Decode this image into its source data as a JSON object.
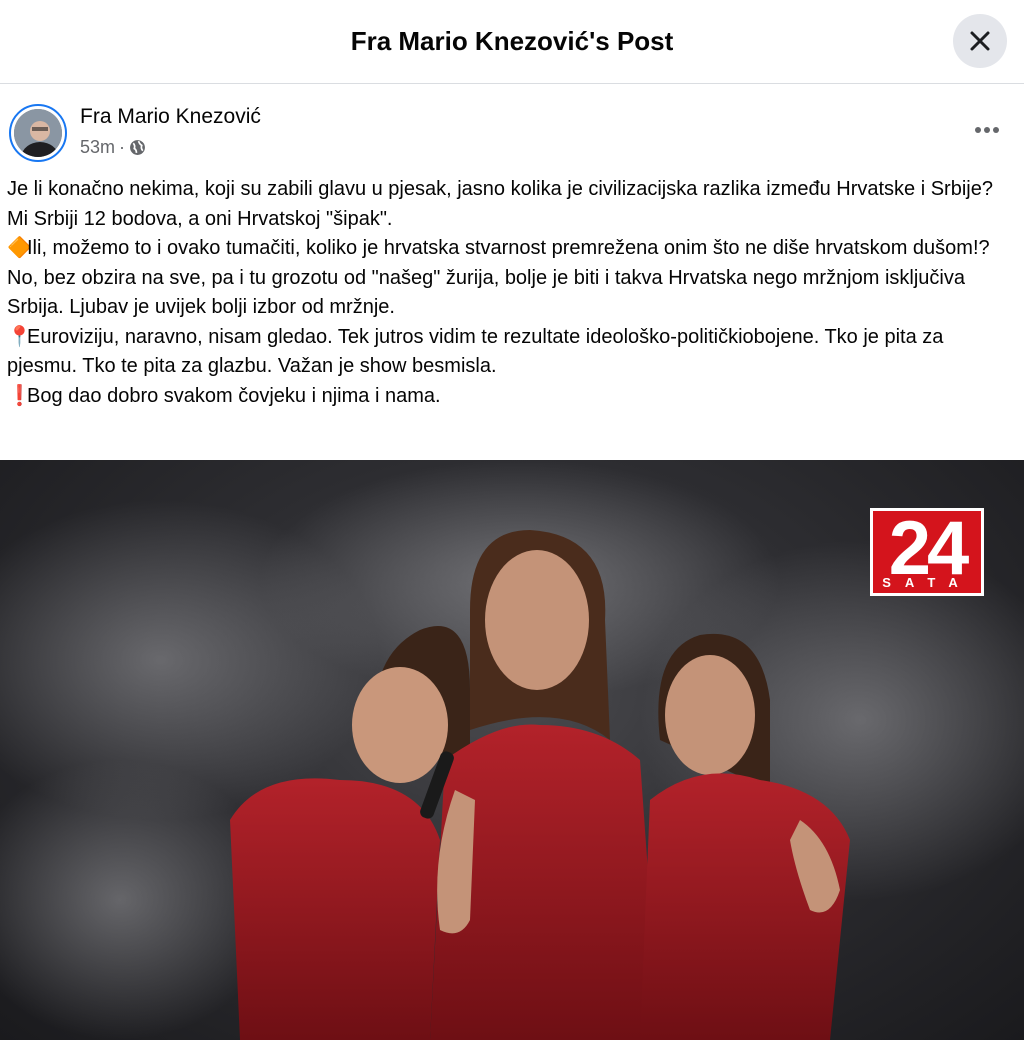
{
  "dialog": {
    "title": "Fra Mario Knezović's Post",
    "close_icon": "close-icon"
  },
  "post": {
    "author": "Fra Mario Knezović",
    "time": "53m",
    "meta_separator": "·",
    "privacy_icon": "globe-icon",
    "more_icon": "more-horizontal-icon",
    "paragraphs": [
      {
        "emoji": "",
        "text": "Je li konačno nekima, koji su zabili glavu u pjesak, jasno kolika je civilizacijska razlika između Hrvatske i Srbije? Mi Srbiji 12 bodova, a oni Hrvatskoj \"šipak\"."
      },
      {
        "emoji": "🔶",
        "text": "Ili, možemo to i ovako tumačiti, koliko je hrvatska stvarnost premrežena onim što ne diše hrvatskom dušom!?"
      },
      {
        "emoji": "",
        "text": "No, bez obzira na sve, pa i tu grozotu od \"našeg\" žurija, bolje je biti i takva Hrvatska nego mržnjom isključiva Srbija. Ljubav je uvijek bolji izbor od mržnje."
      },
      {
        "emoji": "📍",
        "text": "Euroviziju, naravno, nisam gledao. Tek jutros vidim te rezultate ideološko-političkiobojene. Tko je pita za pjesmu. Tko te pita za glazbu. Važan je show besmisla."
      },
      {
        "emoji": "❗",
        "text": "Bog dao dobro svakom čovjeku i njima i nama."
      }
    ],
    "photo": {
      "logo_number": "24",
      "logo_text": "SATA"
    }
  },
  "colors": {
    "accent": "#1877f2",
    "secondary_text": "#65676b",
    "logo_red": "#d4141c",
    "dress_red": "#9e1a20"
  }
}
